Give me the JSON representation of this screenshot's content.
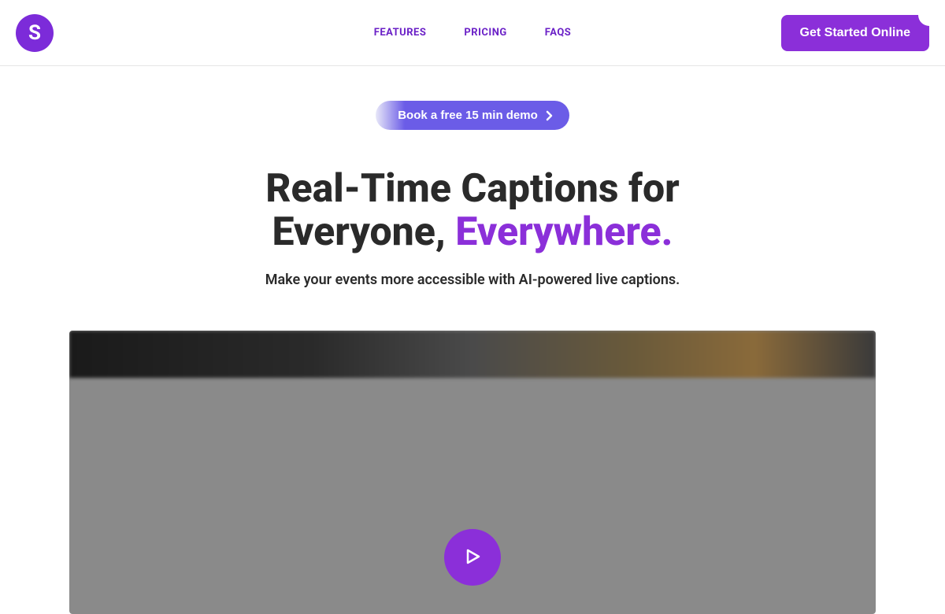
{
  "logo": {
    "letter": "S"
  },
  "nav": {
    "features": "FEATURES",
    "pricing": "PRICING",
    "faqs": "FAQS"
  },
  "header": {
    "cta": "Get Started Online"
  },
  "hero": {
    "demo_button": "Book a free 15 min demo",
    "title_line1": "Real-Time Captions for",
    "title_line2_prefix": "Everyone, ",
    "title_line2_highlight": "Everywhere.",
    "subtitle": "Make your events more accessible with AI-powered live captions."
  },
  "colors": {
    "brand_purple": "#8b2fd9",
    "brand_indigo": "#6b5ce7",
    "text_dark": "#2a2a2a"
  }
}
